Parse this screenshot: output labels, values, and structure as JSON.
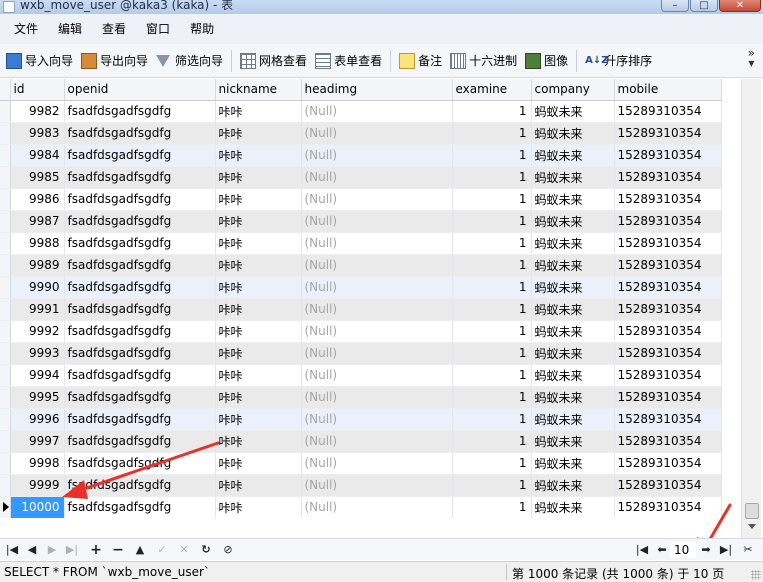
{
  "window": {
    "title": "wxb_move_user @kaka3 (kaka) - 表"
  },
  "menu": [
    "文件",
    "编辑",
    "查看",
    "窗口",
    "帮助"
  ],
  "toolbar": {
    "import_label": "导入向导",
    "export_label": "导出向导",
    "filter_label": "筛选向导",
    "grid_view_label": "网格查看",
    "form_view_label": "表单查看",
    "memo_label": "备注",
    "hex_label": "十六进制",
    "image_label": "图像",
    "sort_label": "升序排序",
    "sort_icon_text": "A↓Z",
    "more_text": "»"
  },
  "grid": {
    "columns": [
      "id",
      "openid",
      "nickname",
      "headimg",
      "examine",
      "company",
      "mobile"
    ],
    "rows": [
      [
        "9982",
        "fsadfdsgadfsgdfg",
        "咔咔",
        "(Null)",
        "1",
        "蚂蚁未来",
        "15289310354"
      ],
      [
        "9983",
        "fsadfdsgadfsgdfg",
        "咔咔",
        "(Null)",
        "1",
        "蚂蚁未来",
        "15289310354"
      ],
      [
        "9984",
        "fsadfdsgadfsgdfg",
        "咔咔",
        "(Null)",
        "1",
        "蚂蚁未来",
        "15289310354"
      ],
      [
        "9985",
        "fsadfdsgadfsgdfg",
        "咔咔",
        "(Null)",
        "1",
        "蚂蚁未来",
        "15289310354"
      ],
      [
        "9986",
        "fsadfdsgadfsgdfg",
        "咔咔",
        "(Null)",
        "1",
        "蚂蚁未来",
        "15289310354"
      ],
      [
        "9987",
        "fsadfdsgadfsgdfg",
        "咔咔",
        "(Null)",
        "1",
        "蚂蚁未来",
        "15289310354"
      ],
      [
        "9988",
        "fsadfdsgadfsgdfg",
        "咔咔",
        "(Null)",
        "1",
        "蚂蚁未来",
        "15289310354"
      ],
      [
        "9989",
        "fsadfdsgadfsgdfg",
        "咔咔",
        "(Null)",
        "1",
        "蚂蚁未来",
        "15289310354"
      ],
      [
        "9990",
        "fsadfdsgadfsgdfg",
        "咔咔",
        "(Null)",
        "1",
        "蚂蚁未来",
        "15289310354"
      ],
      [
        "9991",
        "fsadfdsgadfsgdfg",
        "咔咔",
        "(Null)",
        "1",
        "蚂蚁未来",
        "15289310354"
      ],
      [
        "9992",
        "fsadfdsgadfsgdfg",
        "咔咔",
        "(Null)",
        "1",
        "蚂蚁未来",
        "15289310354"
      ],
      [
        "9993",
        "fsadfdsgadfsgdfg",
        "咔咔",
        "(Null)",
        "1",
        "蚂蚁未来",
        "15289310354"
      ],
      [
        "9994",
        "fsadfdsgadfsgdfg",
        "咔咔",
        "(Null)",
        "1",
        "蚂蚁未来",
        "15289310354"
      ],
      [
        "9995",
        "fsadfdsgadfsgdfg",
        "咔咔",
        "(Null)",
        "1",
        "蚂蚁未来",
        "15289310354"
      ],
      [
        "9996",
        "fsadfdsgadfsgdfg",
        "咔咔",
        "(Null)",
        "1",
        "蚂蚁未来",
        "15289310354"
      ],
      [
        "9997",
        "fsadfdsgadfsgdfg",
        "咔咔",
        "(Null)",
        "1",
        "蚂蚁未来",
        "15289310354"
      ],
      [
        "9998",
        "fsadfdsgadfsgdfg",
        "咔咔",
        "(Null)",
        "1",
        "蚂蚁未来",
        "15289310354"
      ],
      [
        "9999",
        "fsadfdsgadfsgdfg",
        "咔咔",
        "(Null)",
        "1",
        "蚂蚁未来",
        "15289310354"
      ],
      [
        "10000",
        "fsadfdsgadfsgdfg",
        "咔咔",
        "(Null)",
        "1",
        "蚂蚁未来",
        "15289310354"
      ]
    ]
  },
  "navigation": {
    "current_page": "10"
  },
  "status": {
    "sql": "SELECT * FROM `wxb_move_user`",
    "info": "第 1000 条记录 (共 1000 条) 于 10 页"
  },
  "colors": {
    "selection": "#3399ff",
    "annotation": "#e8312a"
  }
}
